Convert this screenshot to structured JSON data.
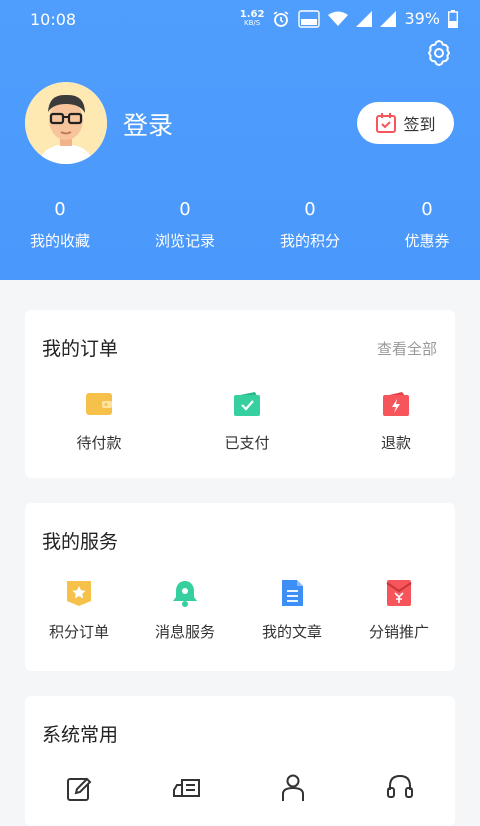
{
  "status_bar": {
    "time": "10:08",
    "speed_value": "1.62",
    "speed_unit": "KB/S",
    "battery": "39%"
  },
  "profile": {
    "login_label": "登录",
    "signin_label": "签到"
  },
  "stats": [
    {
      "value": "0",
      "label": "我的收藏"
    },
    {
      "value": "0",
      "label": "浏览记录"
    },
    {
      "value": "0",
      "label": "我的积分"
    },
    {
      "value": "0",
      "label": "优惠券"
    }
  ],
  "orders": {
    "title": "我的订单",
    "more": "查看全部",
    "items": [
      {
        "label": "待付款",
        "icon": "wallet-icon",
        "color": "#f6c14b"
      },
      {
        "label": "已支付",
        "icon": "paid-wallet-icon",
        "color": "#36cfa0"
      },
      {
        "label": "退款",
        "icon": "refund-icon",
        "color": "#f5555b"
      }
    ]
  },
  "services": {
    "title": "我的服务",
    "items": [
      {
        "label": "积分订单",
        "icon": "points-icon",
        "color": "#f6c14b"
      },
      {
        "label": "消息服务",
        "icon": "bell-icon",
        "color": "#36cfa0"
      },
      {
        "label": "我的文章",
        "icon": "document-icon",
        "color": "#3d8ff5"
      },
      {
        "label": "分销推广",
        "icon": "distribution-icon",
        "color": "#f5555b"
      }
    ]
  },
  "system": {
    "title": "系统常用",
    "icons": [
      "edit-icon",
      "delivery-truck-icon",
      "person-icon",
      "headset-icon"
    ]
  }
}
